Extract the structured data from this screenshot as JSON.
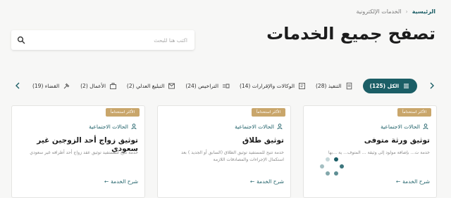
{
  "breadcrumb": {
    "home": "الرئيسية",
    "current": "الخدمات الإلكترونية"
  },
  "page": {
    "title": "تصفح جميع الخدمات"
  },
  "search": {
    "placeholder": "اكتب هنا للبحث"
  },
  "tabs": [
    {
      "label": "الكل (125)",
      "icon": "list-icon",
      "active": true
    },
    {
      "label": "التنفيذ (28)",
      "icon": "document-icon"
    },
    {
      "label": "الوكالات والإقرارات (14)",
      "icon": "agency-icon"
    },
    {
      "label": "التراخيص (24)",
      "icon": "license-icon"
    },
    {
      "label": "التبليغ العدلي (2)",
      "icon": "notification-icon"
    },
    {
      "label": "الأعمال (2)",
      "icon": "briefcase-icon"
    },
    {
      "label": "القضاء (19)",
      "icon": "judiciary-icon"
    }
  ],
  "cards": [
    {
      "badge": "الأكثر استخداماً",
      "category": "الحالات الاجتماعية",
      "title": "توثيق ورثة متوفى",
      "description": "خدمة ت... بإضافة مولود إلى وثيقة ... المتوف... ية ...بها",
      "link": "شرح الخدمة"
    },
    {
      "badge": "الأكثر استخداماً",
      "category": "الحالات الاجتماعية",
      "title": "توثيق طلاق",
      "description": "خدمة تتيح للمستفيد توثيق الطلاق (السابق أو الجديد ) بعد استكمال الإجراءات والمصادقات اللازمة",
      "link": "شرح الخدمة"
    },
    {
      "badge": "الأكثر استخداماً",
      "category": "الحالات الاجتماعية",
      "title": "توثيق زواج أحد الزوجين غير سعودي",
      "description": "خدمة تتيح للمستفيد توثيق عقد زواج أحد أطرافه غير سعودي",
      "link": "شرح الخدمة"
    }
  ],
  "colors": {
    "primary": "#1b5e66",
    "badge": "#c9a66b",
    "background": "#f7f7f6"
  }
}
